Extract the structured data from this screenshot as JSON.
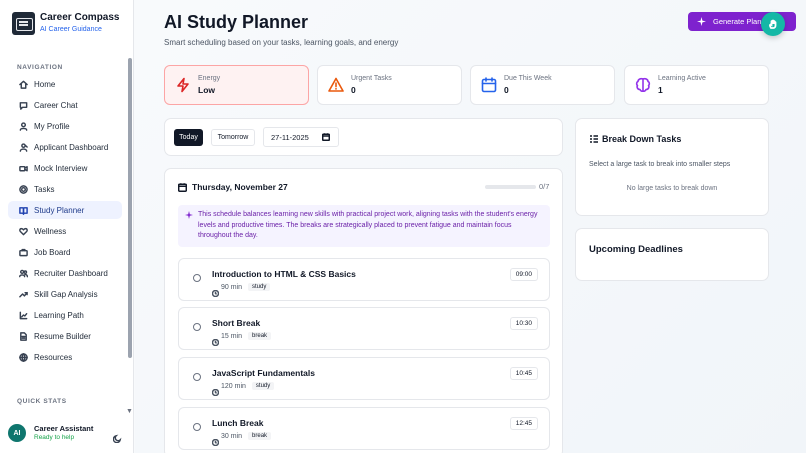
{
  "brand": {
    "title": "Career Compass",
    "subtitle": "AI Career Guidance"
  },
  "sidebar": {
    "heading": "NAVIGATION",
    "items": [
      {
        "label": "Home",
        "icon": "home-icon"
      },
      {
        "label": "Career Chat",
        "icon": "chat-icon"
      },
      {
        "label": "My Profile",
        "icon": "user-icon"
      },
      {
        "label": "Applicant Dashboard",
        "icon": "id-card-icon"
      },
      {
        "label": "Mock Interview",
        "icon": "video-icon"
      },
      {
        "label": "Tasks",
        "icon": "target-icon"
      },
      {
        "label": "Study Planner",
        "icon": "book-icon",
        "active": true
      },
      {
        "label": "Wellness",
        "icon": "heart-icon"
      },
      {
        "label": "Job Board",
        "icon": "briefcase-icon"
      },
      {
        "label": "Recruiter Dashboard",
        "icon": "users-icon"
      },
      {
        "label": "Skill Gap Analysis",
        "icon": "trend-icon"
      },
      {
        "label": "Learning Path",
        "icon": "path-icon"
      },
      {
        "label": "Resume Builder",
        "icon": "file-icon"
      },
      {
        "label": "Resources",
        "icon": "globe-icon"
      }
    ],
    "quick_stats_heading": "QUICK STATS",
    "assistant": {
      "initials": "AI",
      "name": "Career Assistant",
      "status": "Ready to help"
    }
  },
  "header": {
    "title": "AI Study Planner",
    "subtitle": "Smart scheduling based on your tasks, learning goals, and energy",
    "generate_label": "Generate Plan"
  },
  "stats": [
    {
      "label": "Energy",
      "value": "Low",
      "icon": "lightning-icon",
      "color": "#dc2626"
    },
    {
      "label": "Urgent Tasks",
      "value": "0",
      "icon": "warning-icon",
      "color": "#ea580c"
    },
    {
      "label": "Due This Week",
      "value": "0",
      "icon": "calendar-icon",
      "color": "#2563eb"
    },
    {
      "label": "Learning Active",
      "value": "1",
      "icon": "brain-icon",
      "color": "#9333ea"
    }
  ],
  "date_controls": {
    "today_label": "Today",
    "tomorrow_label": "Tomorrow",
    "date_value": "27-11-2025"
  },
  "schedule": {
    "date": "Thursday, November 27",
    "progress_text": "0/7",
    "progress_fraction": 0,
    "note": "This schedule balances learning new skills with practical project work, aligning tasks with the student's energy levels and productive times. The breaks are strategically placed to prevent fatigue and maintain focus throughout the day.",
    "tasks": [
      {
        "title": "Introduction to HTML & CSS Basics",
        "duration": "90 min",
        "tag": "study",
        "time": "09:00"
      },
      {
        "title": "Short Break",
        "duration": "15 min",
        "tag": "break",
        "time": "10:30"
      },
      {
        "title": "JavaScript Fundamentals",
        "duration": "120 min",
        "tag": "study",
        "time": "10:45"
      },
      {
        "title": "Lunch Break",
        "duration": "30 min",
        "tag": "break",
        "time": "12:45"
      }
    ]
  },
  "breakdown": {
    "title": "Break Down Tasks",
    "description": "Select a large task to break into smaller steps",
    "empty": "No large tasks to break down"
  },
  "deadlines": {
    "title": "Upcoming Deadlines"
  },
  "colors": {
    "accent": "#7e22ce",
    "brand_blue": "#2563eb",
    "fab": "#14b8a6"
  }
}
